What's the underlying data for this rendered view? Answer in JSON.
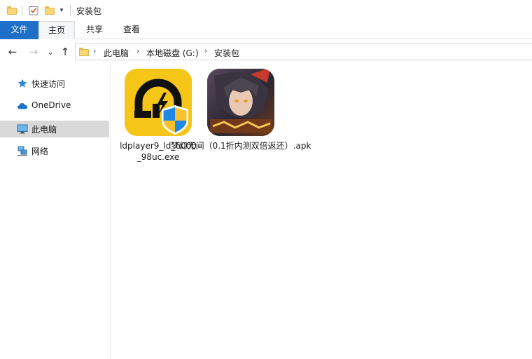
{
  "window": {
    "title": "安装包"
  },
  "ribbon": {
    "tabs": [
      {
        "label": "文件"
      },
      {
        "label": "主页"
      },
      {
        "label": "共享"
      },
      {
        "label": "查看"
      }
    ],
    "file_color": "#1e6fc7"
  },
  "navigation": {
    "back_glyph": "←",
    "forward_glyph": "→",
    "recent_glyph": "⌄",
    "up_glyph": "↑",
    "breadcrumb": [
      {
        "label": "此电脑"
      },
      {
        "label": "本地磁盘 (G:)"
      },
      {
        "label": "安装包"
      }
    ],
    "separator_glyph": "›"
  },
  "sidebar": {
    "items": [
      {
        "label": "快速访问",
        "icon": "star-icon"
      },
      {
        "label": "OneDrive",
        "icon": "cloud-icon"
      },
      {
        "label": "此电脑",
        "icon": "monitor-icon",
        "selected": true
      },
      {
        "label": "网络",
        "icon": "network-icon"
      }
    ]
  },
  "files": [
    {
      "name": "ldplayer9_ld_6000_98uc.exe",
      "icon": "ldplayer-app-icon",
      "color": "#f5c518"
    },
    {
      "name": "梦幻无间（0.1折内测双倍返还）.apk",
      "icon": "game-artwork-icon"
    }
  ],
  "colors": {
    "accent": "#1e6fc7",
    "selected_bg": "#d9d9d9",
    "folder": "#f8d777"
  }
}
